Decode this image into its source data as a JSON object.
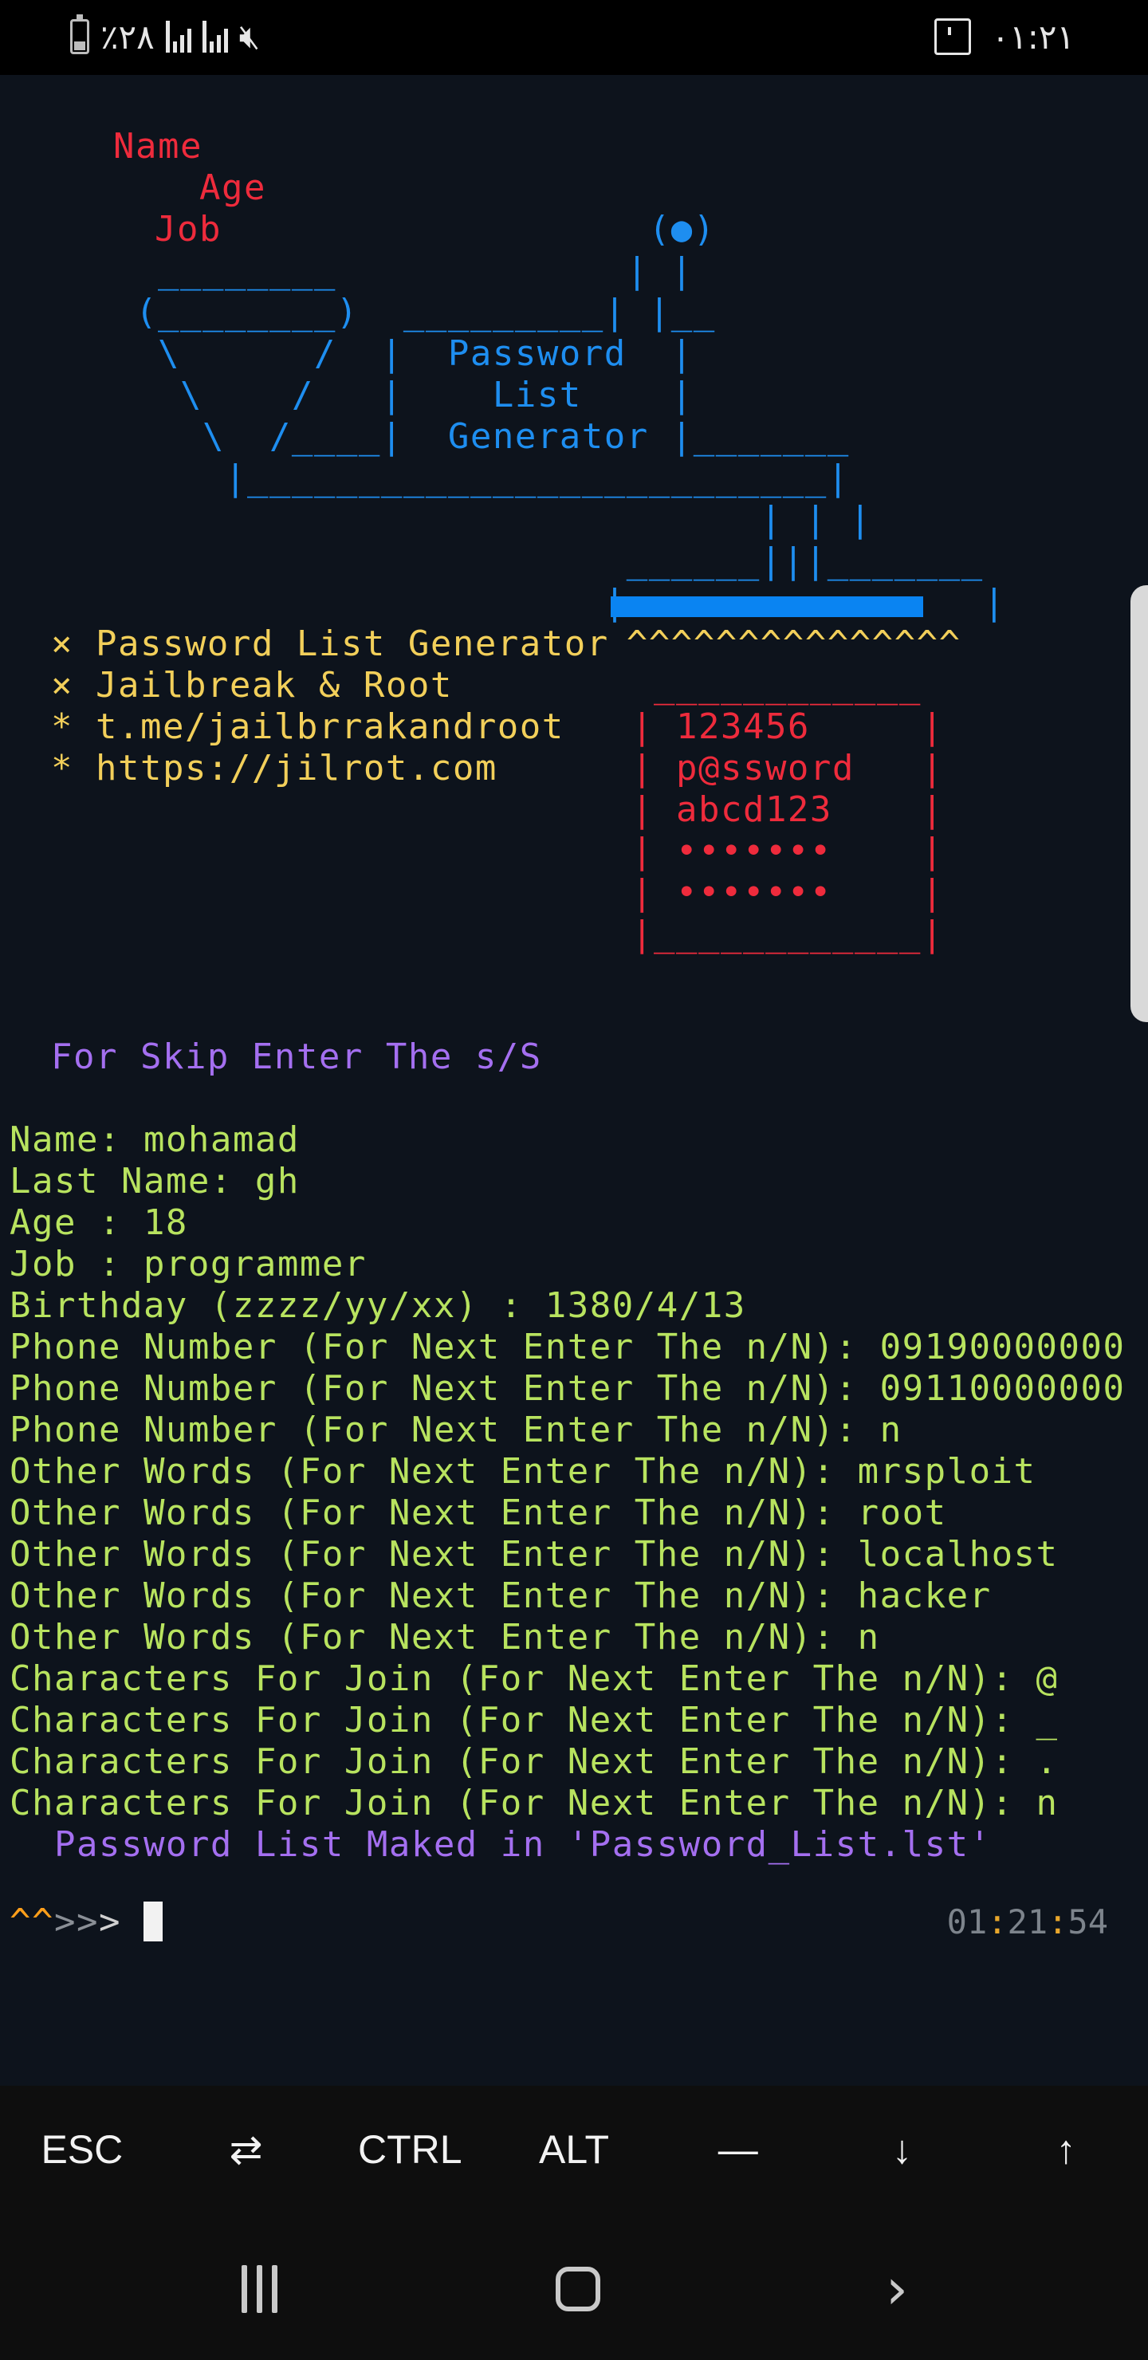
{
  "status_bar": {
    "battery_text": "٪۲۸",
    "time": "۰۱:۲۱"
  },
  "banner": {
    "labels": [
      "Name",
      "  Age",
      "Job"
    ],
    "art_lines": [
      "                        (●)",
      "  ________             | |",
      " (________)  _________| |__",
      "  \\      /  |  Password  |",
      "   \\    /   |    List    |",
      "    \\  /____|  Generator |_______",
      "     |__________________________|",
      "                             | | |",
      "                       ______|||_______",
      "                      |                |",
      "                       ^^^^^^^^^^^^^^^"
    ],
    "info_lines": [
      "× Password List Generator",
      "× Jailbreak & Root",
      "* t.me/jailbrrakandroot",
      "* https://jilrot.com"
    ],
    "sample_box": [
      " ____________",
      "| 123456     |",
      "| p@ssword   |",
      "| abcd123    |",
      "| •••••••    |",
      "| •••••••    |",
      "|____________|"
    ]
  },
  "skip_hint": "For Skip Enter The s/S",
  "session_lines": [
    "Name: mohamad",
    "Last Name: gh",
    "Age : 18",
    "Job : programmer",
    "Birthday (zzzz/yy/xx) : 1380/4/13",
    "Phone Number (For Next Enter The n/N): 09190000000",
    "Phone Number (For Next Enter The n/N): 09110000000",
    "Phone Number (For Next Enter The n/N): n",
    "Other Words (For Next Enter The n/N): mrsploit",
    "Other Words (For Next Enter The n/N): root",
    "Other Words (For Next Enter The n/N): localhost",
    "Other Words (For Next Enter The n/N): hacker",
    "Other Words (For Next Enter The n/N): n",
    "Characters For Join (For Next Enter The n/N): @",
    "Characters For Join (For Next Enter The n/N): _",
    "Characters For Join (For Next Enter The n/N): .",
    "Characters For Join (For Next Enter The n/N): n"
  ],
  "result_line": "  Password List Maked in 'Password_List.lst'",
  "prompt": {
    "carets": "^^",
    "arrows_dim": ">>",
    "arrow": ">",
    "clock_h": "01",
    "clock_sep1": ":",
    "clock_m": "21",
    "clock_sep2": ":",
    "clock_s": "54"
  },
  "extra_keys": [
    "ESC",
    "⇄",
    "CTRL",
    "ALT",
    "—",
    "↓",
    "↑"
  ],
  "colors": {
    "background": "#0d131c",
    "red": "#ee2b3c",
    "blue": "#1e8ef0",
    "yellow": "#f2cf5a",
    "purple": "#a46ff0",
    "green": "#b8e35f"
  }
}
